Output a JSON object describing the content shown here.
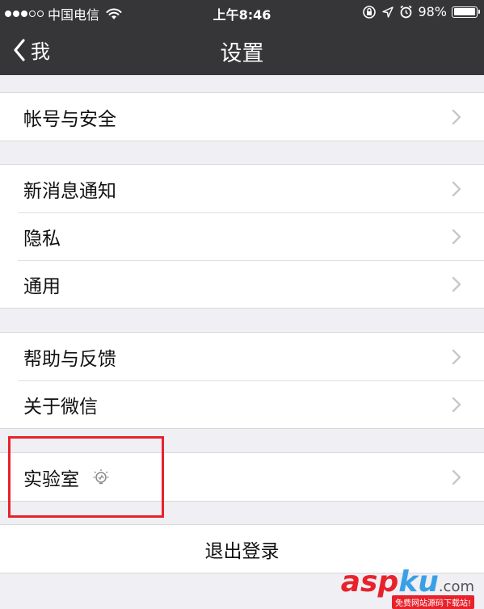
{
  "status_bar": {
    "carrier": "中国电信",
    "time": "上午8:46",
    "battery": "98%",
    "battery_level": 0.98,
    "signal_bars_filled": 3,
    "signal_bars_total": 5
  },
  "nav": {
    "back_label": "我",
    "title": "设置"
  },
  "groups": [
    {
      "items": [
        "帐号与安全"
      ]
    },
    {
      "items": [
        "新消息通知",
        "隐私",
        "通用"
      ]
    },
    {
      "items": [
        "帮助与反馈",
        "关于微信"
      ]
    },
    {
      "items": [
        "实验室"
      ]
    }
  ],
  "logout_label": "退出登录",
  "colors": {
    "nav_background": "#363538",
    "page_background": "#efeff4",
    "highlight": "#e8222b",
    "chevron": "#c7c7cc"
  },
  "icons": {
    "back": "chevron-left-icon",
    "lab": "bulb-icon",
    "row": "chevron-right-icon"
  },
  "watermark": {
    "asp": "asp",
    "ku": "ku",
    "domain": ".com",
    "tagline": "免费网站源码下载站!"
  }
}
